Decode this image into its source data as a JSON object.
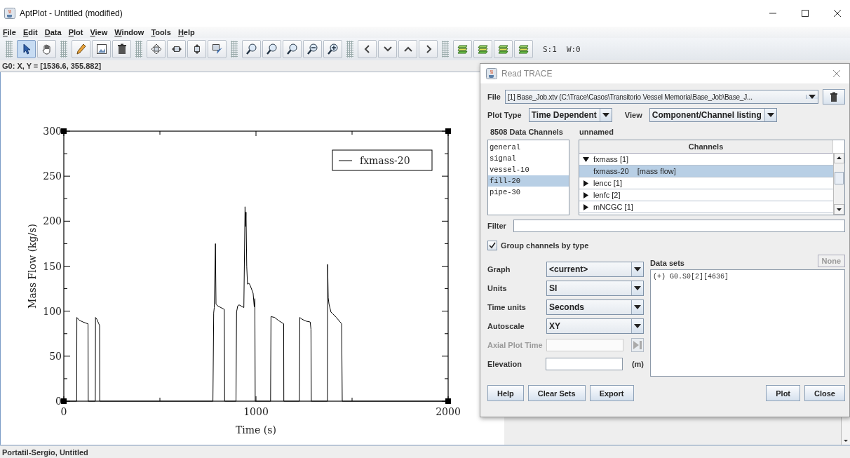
{
  "window": {
    "title": "AptPlot - Untitled (modified)"
  },
  "menu": [
    "File",
    "Edit",
    "Data",
    "Plot",
    "View",
    "Window",
    "Tools",
    "Help"
  ],
  "toolbar": {
    "groups": [
      [
        {
          "selected": true
        },
        {
          "selected": false
        }
      ],
      [
        {
          "selected": false
        },
        {
          "selected": false
        },
        {
          "selected": false
        }
      ],
      [
        {
          "selected": false
        },
        {
          "selected": false
        },
        {
          "selected": false
        },
        {
          "selected": false
        }
      ],
      [
        {
          "selected": false
        },
        {
          "selected": false
        },
        {
          "selected": false
        },
        {
          "selected": false
        },
        {
          "selected": false
        }
      ],
      [
        {
          "selected": false
        },
        {
          "selected": false
        },
        {
          "selected": false
        },
        {
          "selected": false
        }
      ],
      [
        {
          "selected": false
        },
        {
          "selected": false
        },
        {
          "selected": false
        },
        {
          "selected": false
        }
      ]
    ],
    "scale": "S:1",
    "width": "W:0"
  },
  "coordinates": "G0: X, Y = [1536.6, 355.882]",
  "plot": {
    "chart_data": {
      "type": "line",
      "xlabel": "Time (s)",
      "ylabel": "Mass Flow (kg/s)",
      "xlim": [
        0,
        2000
      ],
      "ylim": [
        0,
        300
      ],
      "xticks": [
        0,
        1000,
        2000
      ],
      "yticks": [
        0,
        50,
        100,
        150,
        200,
        250,
        300
      ],
      "x": [
        0,
        67,
        68,
        80,
        100,
        124,
        126,
        127,
        164,
        165,
        172,
        182,
        186,
        187,
        776,
        780,
        783,
        789,
        792,
        800,
        835,
        837,
        896,
        899,
        905,
        912,
        937,
        943,
        946,
        948,
        952,
        956,
        963,
        969,
        985,
        991,
        994,
        996,
        1076,
        1078,
        1097,
        1115,
        1129,
        1144,
        1145,
        1226,
        1228,
        1240,
        1260,
        1282,
        1286,
        1288,
        1372,
        1373,
        1376,
        1380,
        1390,
        1400,
        1418,
        1446,
        1449,
        2000
      ],
      "series": [
        {
          "name": "fxmass-20",
          "color": "#000000",
          "values": [
            0,
            0,
            93,
            90,
            88,
            86,
            86,
            0,
            0,
            93,
            91,
            86,
            84,
            0,
            0,
            98,
            104,
            175,
            108,
            106,
            102,
            0,
            0,
            99,
            106,
            107,
            104,
            216,
            194,
            210,
            150,
            130,
            131,
            129,
            120,
            105,
            114,
            0,
            0,
            94,
            93,
            90,
            88,
            86,
            0,
            0,
            93,
            91,
            89,
            88,
            80,
            0,
            0,
            152,
            115,
            108,
            99,
            97,
            93,
            86,
            0,
            0
          ]
        }
      ]
    }
  },
  "status_bar": "Portatil-Sergio, Untitled",
  "dialog": {
    "title": "Read TRACE",
    "file": {
      "label": "File",
      "value": "[1] Base_Job.xtv (C:\\Trace\\Casos\\Transitorio Vessel Memoria\\Base_Job\\Base_J..."
    },
    "plot_type": {
      "label": "Plot Type",
      "value": "Time Dependent"
    },
    "view": {
      "label": "View",
      "value": "Component/Channel listing"
    },
    "channel_count": "8508 Data Channels",
    "group_name": "unnamed",
    "components": [
      {
        "label": "general",
        "selected": false
      },
      {
        "label": "signal",
        "selected": false
      },
      {
        "label": "vessel-10",
        "selected": false
      },
      {
        "label": "fill-20",
        "selected": true
      },
      {
        "label": "pipe-30",
        "selected": false
      }
    ],
    "channels": {
      "header": "Channels",
      "rows": [
        {
          "label": "fxmass [1]",
          "expanded": true,
          "selected": false,
          "children": [
            {
              "label": "fxmass-20",
              "detail": "[mass flow]",
              "selected": true
            }
          ]
        },
        {
          "label": "lencc [1]",
          "expanded": false,
          "selected": false
        },
        {
          "label": "lenfc [2]",
          "expanded": false,
          "selected": false
        },
        {
          "label": "mNCGC [1]",
          "expanded": false,
          "selected": false
        }
      ]
    },
    "filter": {
      "label": "Filter"
    },
    "group_by_type": {
      "label": "Group channels by type",
      "checked": true
    },
    "options": [
      {
        "label": "Graph",
        "value": "<current>"
      },
      {
        "label": "Units",
        "value": "SI"
      },
      {
        "label": "Time units",
        "value": "Seconds"
      },
      {
        "label": "Autoscale",
        "value": "XY"
      }
    ],
    "axial_plot_time": {
      "label": "Axial Plot Time",
      "disabled": true
    },
    "elevation": {
      "label": "Elevation",
      "unit": "(m)"
    },
    "data_sets": {
      "label": "Data sets",
      "none_button": {
        "label": "None",
        "disabled": true
      },
      "items": [
        "(+) G0.S0[2][4636]"
      ]
    },
    "buttons_left": [
      "Help",
      "Clear Sets",
      "Export"
    ],
    "buttons_right": [
      "Plot",
      "Close"
    ]
  }
}
